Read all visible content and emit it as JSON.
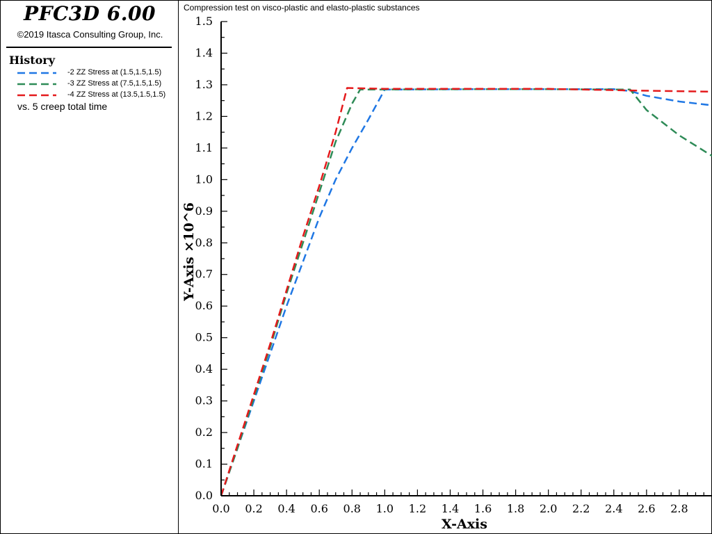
{
  "app": {
    "title": "PFC3D 6.00",
    "copyright": "©2019 Itasca Consulting Group, Inc."
  },
  "history": {
    "heading": "History",
    "vs_label": "vs. 5 creep total time"
  },
  "chart_data": {
    "type": "line",
    "title": "Compression test on visco-plastic and elasto-plastic substances",
    "xlabel": "X-Axis",
    "ylabel": "Y-Axis ×10^6",
    "xlim": [
      0.0,
      3.0
    ],
    "ylim": [
      0.0,
      1.5
    ],
    "xticks": [
      "0.0",
      "0.2",
      "0.4",
      "0.6",
      "0.8",
      "1.0",
      "1.2",
      "1.4",
      "1.6",
      "1.8",
      "2.0",
      "2.2",
      "2.4",
      "2.6",
      "2.8"
    ],
    "yticks": [
      "0.0",
      "0.1",
      "0.2",
      "0.3",
      "0.4",
      "0.5",
      "0.6",
      "0.7",
      "0.8",
      "0.9",
      "1.0",
      "1.1",
      "1.2",
      "1.3",
      "1.4",
      "1.5"
    ],
    "grid": false,
    "legend_position": "left-panel",
    "series": [
      {
        "name": "-2 ZZ Stress at (1.5,1.5,1.5)",
        "color": "#1f77e4",
        "dash": "dashed",
        "points": [
          [
            0.0,
            0.0
          ],
          [
            0.1,
            0.15
          ],
          [
            0.2,
            0.3
          ],
          [
            0.3,
            0.45
          ],
          [
            0.4,
            0.6
          ],
          [
            0.5,
            0.74
          ],
          [
            0.6,
            0.88
          ],
          [
            0.7,
            1.0
          ],
          [
            0.8,
            1.1
          ],
          [
            0.9,
            1.19
          ],
          [
            1.0,
            1.285
          ],
          [
            1.5,
            1.286
          ],
          [
            2.0,
            1.286
          ],
          [
            2.4,
            1.286
          ],
          [
            2.5,
            1.28
          ],
          [
            2.6,
            1.265
          ],
          [
            2.8,
            1.247
          ],
          [
            3.0,
            1.235
          ]
        ]
      },
      {
        "name": "-3 ZZ Stress at (7.5,1.5,1.5)",
        "color": "#2e8b57",
        "dash": "dashed",
        "points": [
          [
            0.0,
            0.0
          ],
          [
            0.1,
            0.15
          ],
          [
            0.2,
            0.31
          ],
          [
            0.3,
            0.47
          ],
          [
            0.4,
            0.64
          ],
          [
            0.5,
            0.8
          ],
          [
            0.6,
            0.96
          ],
          [
            0.7,
            1.12
          ],
          [
            0.8,
            1.24
          ],
          [
            0.85,
            1.285
          ],
          [
            1.5,
            1.286
          ],
          [
            2.0,
            1.286
          ],
          [
            2.5,
            1.285
          ],
          [
            2.6,
            1.22
          ],
          [
            2.8,
            1.14
          ],
          [
            3.0,
            1.075
          ]
        ]
      },
      {
        "name": "-4 ZZ Stress at (13.5,1.5,1.5)",
        "color": "#e41a1c",
        "dash": "dashed",
        "points": [
          [
            0.0,
            0.0
          ],
          [
            0.1,
            0.16
          ],
          [
            0.2,
            0.32
          ],
          [
            0.3,
            0.48
          ],
          [
            0.4,
            0.65
          ],
          [
            0.5,
            0.82
          ],
          [
            0.6,
            0.98
          ],
          [
            0.7,
            1.15
          ],
          [
            0.77,
            1.29
          ],
          [
            1.0,
            1.287
          ],
          [
            1.5,
            1.287
          ],
          [
            2.0,
            1.287
          ],
          [
            2.5,
            1.282
          ],
          [
            3.0,
            1.278
          ]
        ]
      }
    ]
  }
}
